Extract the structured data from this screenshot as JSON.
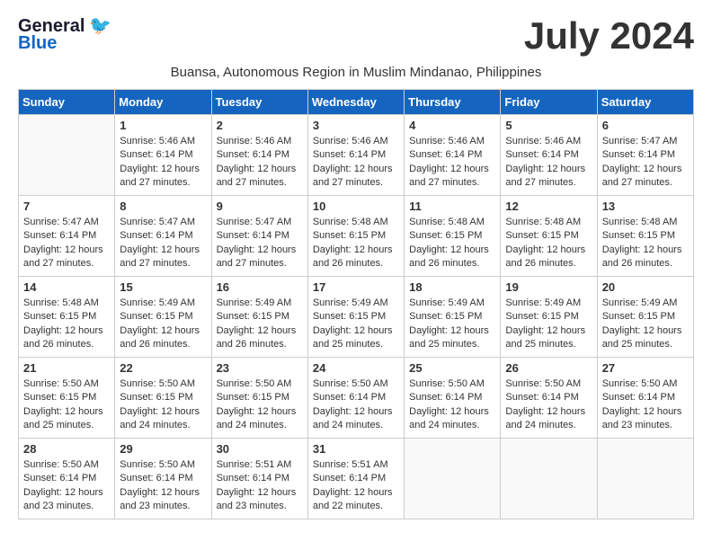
{
  "header": {
    "logo_line1": "General",
    "logo_line2": "Blue",
    "title": "July 2024",
    "location": "Buansa, Autonomous Region in Muslim Mindanao, Philippines"
  },
  "weekdays": [
    "Sunday",
    "Monday",
    "Tuesday",
    "Wednesday",
    "Thursday",
    "Friday",
    "Saturday"
  ],
  "weeks": [
    [
      {
        "day": "",
        "info": ""
      },
      {
        "day": "1",
        "info": "Sunrise: 5:46 AM\nSunset: 6:14 PM\nDaylight: 12 hours\nand 27 minutes."
      },
      {
        "day": "2",
        "info": "Sunrise: 5:46 AM\nSunset: 6:14 PM\nDaylight: 12 hours\nand 27 minutes."
      },
      {
        "day": "3",
        "info": "Sunrise: 5:46 AM\nSunset: 6:14 PM\nDaylight: 12 hours\nand 27 minutes."
      },
      {
        "day": "4",
        "info": "Sunrise: 5:46 AM\nSunset: 6:14 PM\nDaylight: 12 hours\nand 27 minutes."
      },
      {
        "day": "5",
        "info": "Sunrise: 5:46 AM\nSunset: 6:14 PM\nDaylight: 12 hours\nand 27 minutes."
      },
      {
        "day": "6",
        "info": "Sunrise: 5:47 AM\nSunset: 6:14 PM\nDaylight: 12 hours\nand 27 minutes."
      }
    ],
    [
      {
        "day": "7",
        "info": "Sunrise: 5:47 AM\nSunset: 6:14 PM\nDaylight: 12 hours\nand 27 minutes."
      },
      {
        "day": "8",
        "info": "Sunrise: 5:47 AM\nSunset: 6:14 PM\nDaylight: 12 hours\nand 27 minutes."
      },
      {
        "day": "9",
        "info": "Sunrise: 5:47 AM\nSunset: 6:14 PM\nDaylight: 12 hours\nand 27 minutes."
      },
      {
        "day": "10",
        "info": "Sunrise: 5:48 AM\nSunset: 6:15 PM\nDaylight: 12 hours\nand 26 minutes."
      },
      {
        "day": "11",
        "info": "Sunrise: 5:48 AM\nSunset: 6:15 PM\nDaylight: 12 hours\nand 26 minutes."
      },
      {
        "day": "12",
        "info": "Sunrise: 5:48 AM\nSunset: 6:15 PM\nDaylight: 12 hours\nand 26 minutes."
      },
      {
        "day": "13",
        "info": "Sunrise: 5:48 AM\nSunset: 6:15 PM\nDaylight: 12 hours\nand 26 minutes."
      }
    ],
    [
      {
        "day": "14",
        "info": "Sunrise: 5:48 AM\nSunset: 6:15 PM\nDaylight: 12 hours\nand 26 minutes."
      },
      {
        "day": "15",
        "info": "Sunrise: 5:49 AM\nSunset: 6:15 PM\nDaylight: 12 hours\nand 26 minutes."
      },
      {
        "day": "16",
        "info": "Sunrise: 5:49 AM\nSunset: 6:15 PM\nDaylight: 12 hours\nand 26 minutes."
      },
      {
        "day": "17",
        "info": "Sunrise: 5:49 AM\nSunset: 6:15 PM\nDaylight: 12 hours\nand 25 minutes."
      },
      {
        "day": "18",
        "info": "Sunrise: 5:49 AM\nSunset: 6:15 PM\nDaylight: 12 hours\nand 25 minutes."
      },
      {
        "day": "19",
        "info": "Sunrise: 5:49 AM\nSunset: 6:15 PM\nDaylight: 12 hours\nand 25 minutes."
      },
      {
        "day": "20",
        "info": "Sunrise: 5:49 AM\nSunset: 6:15 PM\nDaylight: 12 hours\nand 25 minutes."
      }
    ],
    [
      {
        "day": "21",
        "info": "Sunrise: 5:50 AM\nSunset: 6:15 PM\nDaylight: 12 hours\nand 25 minutes."
      },
      {
        "day": "22",
        "info": "Sunrise: 5:50 AM\nSunset: 6:15 PM\nDaylight: 12 hours\nand 24 minutes."
      },
      {
        "day": "23",
        "info": "Sunrise: 5:50 AM\nSunset: 6:15 PM\nDaylight: 12 hours\nand 24 minutes."
      },
      {
        "day": "24",
        "info": "Sunrise: 5:50 AM\nSunset: 6:14 PM\nDaylight: 12 hours\nand 24 minutes."
      },
      {
        "day": "25",
        "info": "Sunrise: 5:50 AM\nSunset: 6:14 PM\nDaylight: 12 hours\nand 24 minutes."
      },
      {
        "day": "26",
        "info": "Sunrise: 5:50 AM\nSunset: 6:14 PM\nDaylight: 12 hours\nand 24 minutes."
      },
      {
        "day": "27",
        "info": "Sunrise: 5:50 AM\nSunset: 6:14 PM\nDaylight: 12 hours\nand 23 minutes."
      }
    ],
    [
      {
        "day": "28",
        "info": "Sunrise: 5:50 AM\nSunset: 6:14 PM\nDaylight: 12 hours\nand 23 minutes."
      },
      {
        "day": "29",
        "info": "Sunrise: 5:50 AM\nSunset: 6:14 PM\nDaylight: 12 hours\nand 23 minutes."
      },
      {
        "day": "30",
        "info": "Sunrise: 5:51 AM\nSunset: 6:14 PM\nDaylight: 12 hours\nand 23 minutes."
      },
      {
        "day": "31",
        "info": "Sunrise: 5:51 AM\nSunset: 6:14 PM\nDaylight: 12 hours\nand 22 minutes."
      },
      {
        "day": "",
        "info": ""
      },
      {
        "day": "",
        "info": ""
      },
      {
        "day": "",
        "info": ""
      }
    ]
  ]
}
